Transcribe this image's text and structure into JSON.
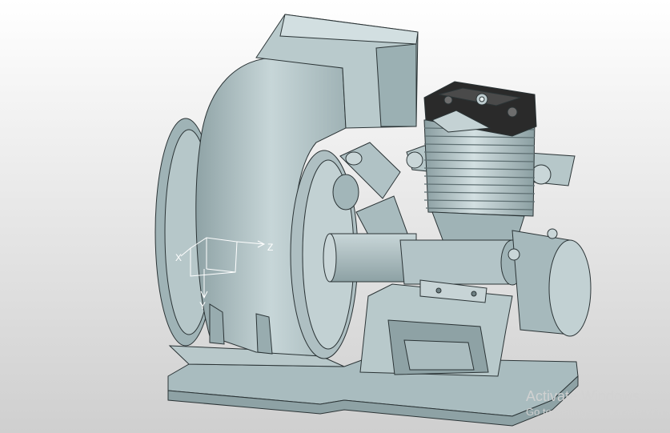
{
  "viewport": {
    "background_top": "#ffffff",
    "background_bottom": "#cfcfcf",
    "model_color": "#b5c6c8",
    "model_shade": "#8ea2a5",
    "edge_color": "#2b3436",
    "head_color": "#2a2a2a"
  },
  "triad": {
    "x_label": "X",
    "y_label": "Y",
    "z_label": "Z"
  },
  "watermark": {
    "title": "Activate Windows",
    "subtitle": "Go to Settings to activate Windows."
  }
}
